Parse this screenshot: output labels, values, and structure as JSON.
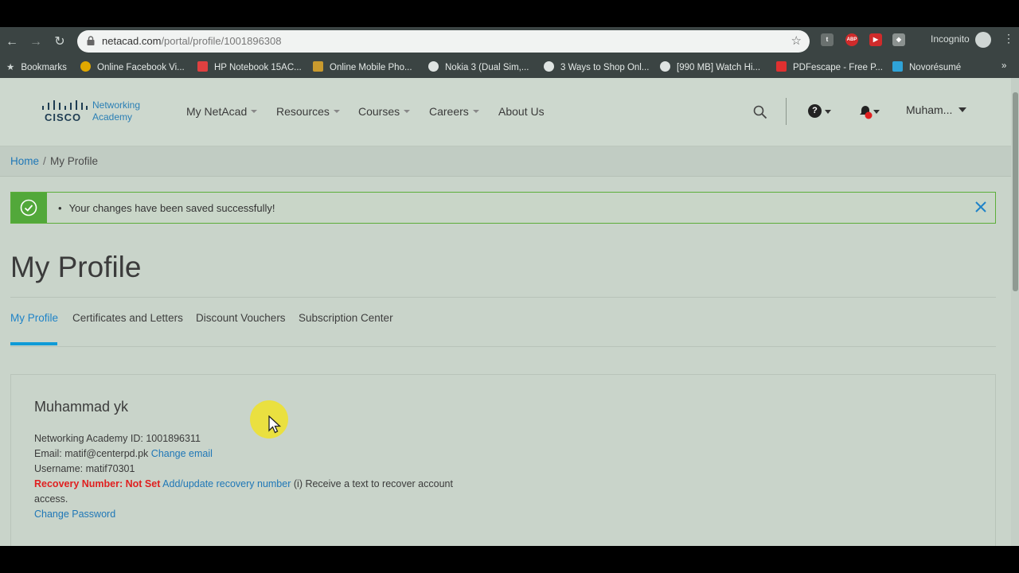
{
  "browser": {
    "url_host": "netacad.com",
    "url_path": "/portal/profile/1001896308",
    "incognito_label": "Incognito",
    "bookmarks": [
      {
        "label": "Bookmarks",
        "icon": "star-icon"
      },
      {
        "label": "Online Facebook Vi...",
        "icon": "globe-icon"
      },
      {
        "label": "HP Notebook 15AC...",
        "icon": "ribbon-icon"
      },
      {
        "label": "Online Mobile Pho...",
        "icon": "phone-icon"
      },
      {
        "label": "Nokia 3 (Dual Sim,...",
        "icon": "site-icon"
      },
      {
        "label": "3 Ways to Shop Onl...",
        "icon": "site-icon"
      },
      {
        "label": "[990 MB] Watch Hi...",
        "icon": "play-icon"
      },
      {
        "label": "PDFescape - Free P...",
        "icon": "pdf-icon"
      },
      {
        "label": "Novorésumé",
        "icon": "n-icon"
      }
    ],
    "more_bookmarks": "»"
  },
  "header": {
    "logo_word": "CISCO",
    "logo_line1": "Networking",
    "logo_line2": "Academy",
    "nav": [
      {
        "label": "My NetAcad",
        "dropdown": true
      },
      {
        "label": "Resources",
        "dropdown": true
      },
      {
        "label": "Courses",
        "dropdown": true
      },
      {
        "label": "Careers",
        "dropdown": true
      },
      {
        "label": "About Us",
        "dropdown": false
      }
    ],
    "user_label": "Muham..."
  },
  "breadcrumb": {
    "home": "Home",
    "separator": "/",
    "current": "My Profile"
  },
  "alert": {
    "message": "Your changes have been saved successfully!",
    "bullet": "•"
  },
  "page_title": "My Profile",
  "tabs": [
    {
      "label": "My Profile",
      "active": true
    },
    {
      "label": "Certificates and Letters",
      "active": false
    },
    {
      "label": "Discount Vouchers",
      "active": false
    },
    {
      "label": "Subscription Center",
      "active": false
    }
  ],
  "profile": {
    "name": "Muhammad yk",
    "academy_id_text": "Networking Academy ID: 1001896311",
    "email_text": "Email: matif@centerpd.pk",
    "change_email": "Change email",
    "username_text": "Username: matif70301",
    "recovery_label": "Recovery Number: Not Set",
    "recovery_link": "Add/update recovery number",
    "recovery_info_1": "(i) Receive a text to recover account",
    "recovery_info_2": "access.",
    "change_password": "Change Password"
  },
  "colors": {
    "accent": "#1f83c8",
    "success": "#52a83a",
    "warning": "#e02020",
    "tab_underline": "#0f9bd7"
  }
}
